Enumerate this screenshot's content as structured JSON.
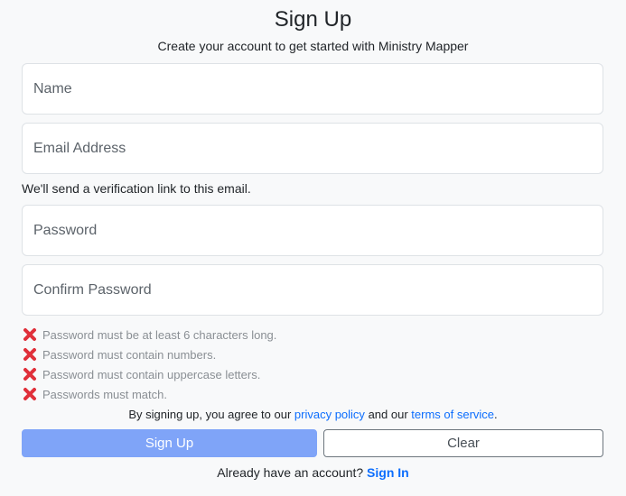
{
  "header": {
    "title": "Sign Up",
    "subtitle": "Create your account to get started with Ministry Mapper"
  },
  "form": {
    "name_placeholder": "Name",
    "email_placeholder": "Email Address",
    "email_help": "We'll send a verification link to this email.",
    "password_placeholder": "Password",
    "confirm_placeholder": "Confirm Password"
  },
  "validation": [
    {
      "icon": "cross-mark-icon",
      "text": "Password must be at least 6 characters long."
    },
    {
      "icon": "cross-mark-icon",
      "text": "Password must contain numbers."
    },
    {
      "icon": "cross-mark-icon",
      "text": "Password must contain uppercase letters."
    },
    {
      "icon": "cross-mark-icon",
      "text": "Passwords must match."
    }
  ],
  "agreement": {
    "prefix": "By signing up, you agree to our",
    "privacy_link": "privacy policy",
    "middle": "and our",
    "terms_link": "terms of service",
    "suffix": "."
  },
  "buttons": {
    "signup_label": "Sign Up",
    "clear_label": "Clear"
  },
  "footer": {
    "prompt": "Already have an account?",
    "signin_link": "Sign In"
  },
  "colors": {
    "primary": "#7fa4f8",
    "link": "#0d6efd",
    "error_icon": "#e0303a"
  }
}
